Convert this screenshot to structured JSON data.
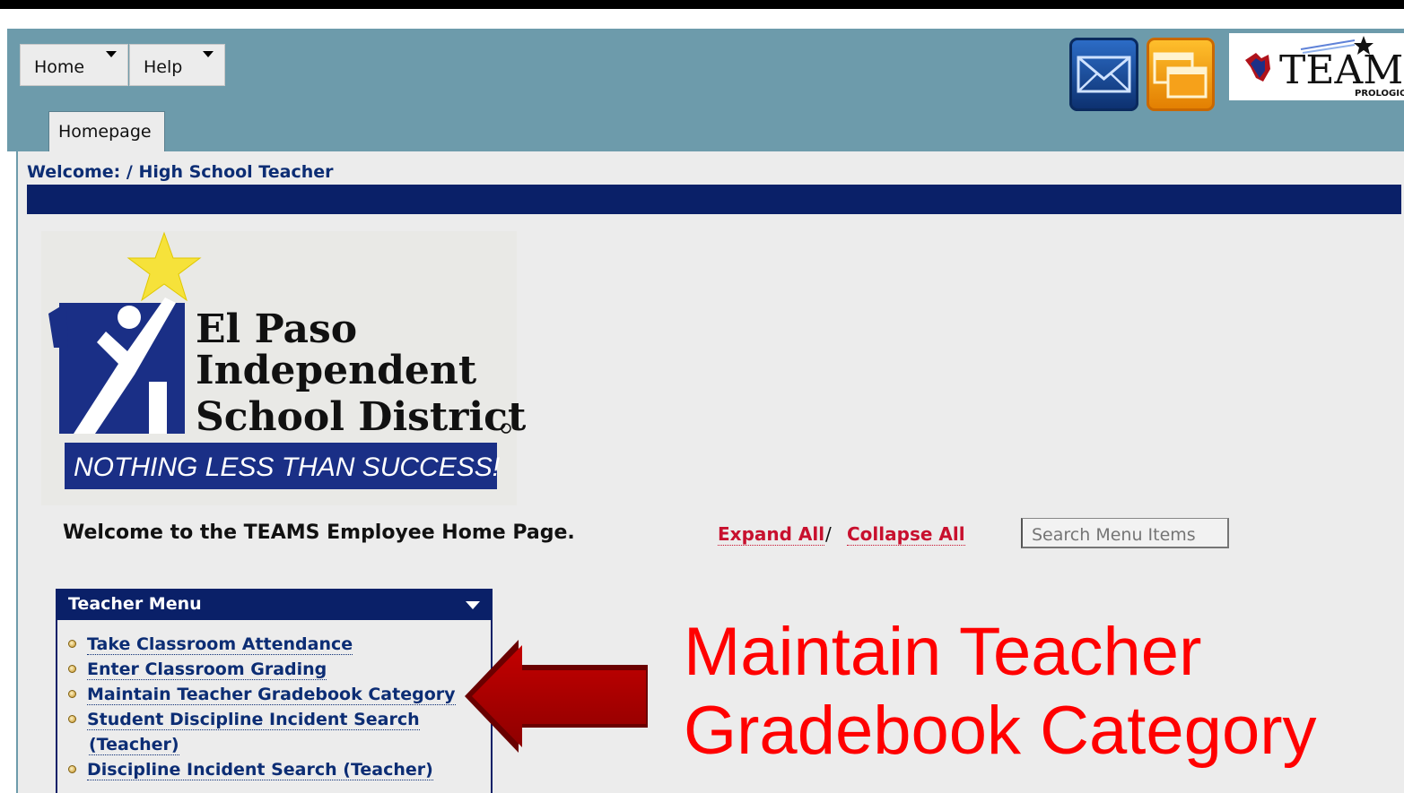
{
  "nav": {
    "menus": [
      {
        "label": "Home"
      },
      {
        "label": "Help"
      }
    ],
    "tabs": [
      {
        "label": "Homepage"
      }
    ]
  },
  "icons": {
    "mail": "envelope-icon",
    "window": "window-icon",
    "logo": "teams-prologic-logo",
    "logo_text": "TEAMS",
    "logo_subtext": "PROLOGIC"
  },
  "welcome_bar": "Welcome: / High School Teacher",
  "district_logo": {
    "line1": "El Paso",
    "line2": "Independent",
    "line3": "School District",
    "tagline": "NOTHING LESS THAN SUCCESS!"
  },
  "welcome_text": "Welcome to the TEAMS Employee Home Page.",
  "expand_all": "Expand All",
  "separator": "/",
  "collapse_all": "Collapse All",
  "search_placeholder": "Search Menu Items",
  "teacher_menu": {
    "title": "Teacher Menu",
    "items": [
      {
        "label": "Take Classroom Attendance"
      },
      {
        "label": "Enter Classroom Grading"
      },
      {
        "label": "Maintain Teacher Gradebook Category"
      },
      {
        "label": "Student Discipline Incident Search"
      },
      {
        "label": "(Teacher)"
      },
      {
        "label": "Discipline Incident Search (Teacher)"
      }
    ]
  },
  "annotation": {
    "line1": "Maintain Teacher",
    "line2": "Gradebook Category",
    "color": "#ff0000"
  },
  "colors": {
    "header_bg": "#6d9bab",
    "navy": "#0a2068",
    "link_red": "#c8102e"
  }
}
